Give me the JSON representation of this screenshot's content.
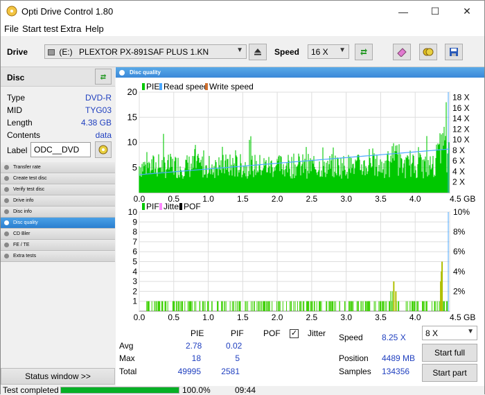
{
  "window": {
    "title": "Opti Drive Control 1.80",
    "minimize": "—",
    "maximize": "☐",
    "close": "✕"
  },
  "menu": {
    "file": "File",
    "start_test": "Start test",
    "extra": "Extra",
    "help": "Help"
  },
  "toolbar": {
    "drive_label": "Drive",
    "drive_letter": "(E:)",
    "drive_name": "PLEXTOR PX-891SAF PLUS 1.KN",
    "speed_label": "Speed",
    "speed_value": "16 X"
  },
  "disc": {
    "header": "Disc",
    "type_label": "Type",
    "type_value": "DVD-R",
    "mid_label": "MID",
    "mid_value": "TYG03",
    "length_label": "Length",
    "length_value": "4.38 GB",
    "contents_label": "Contents",
    "contents_value": "data",
    "label_label": "Label",
    "label_value": "ODC__DVD"
  },
  "nav": {
    "items": [
      "Transfer rate",
      "Create test disc",
      "Verify test disc",
      "Drive info",
      "Disc info",
      "Disc quality",
      "CD Bler",
      "FE / TE",
      "Extra tests"
    ],
    "active_index": 5
  },
  "status_window_button": "Status window >>",
  "panel_title": "Disc quality",
  "chart_data": [
    {
      "type": "area",
      "legend": [
        "PIE",
        "Read speed",
        "Write speed"
      ],
      "legend_colors": [
        "#00c800",
        "#4aa8ff",
        "#d07030"
      ],
      "x_ticks": [
        "0.0",
        "0.5",
        "1.0",
        "1.5",
        "2.0",
        "2.5",
        "3.0",
        "3.5",
        "4.0",
        "4.5 GB"
      ],
      "y_ticks_left": [
        "20",
        "15",
        "10",
        "5"
      ],
      "y_ticks_right": [
        "18 X",
        "16 X",
        "14 X",
        "12 X",
        "10 X",
        "8 X",
        "6 X",
        "4 X",
        "2 X"
      ],
      "xlim": [
        0,
        4.5
      ],
      "ylim": [
        0,
        20
      ],
      "pie_avg": 2.78,
      "pie_max": 18,
      "read_speed_start": 3.4,
      "read_speed_end": 8.25
    },
    {
      "type": "bar",
      "legend": [
        "PIF",
        "Jitter",
        "POF"
      ],
      "legend_colors": [
        "#00c800",
        "#ff88ff",
        "#000000"
      ],
      "x_ticks": [
        "0.0",
        "0.5",
        "1.0",
        "1.5",
        "2.0",
        "2.5",
        "3.0",
        "3.5",
        "4.0",
        "4.5 GB"
      ],
      "y_ticks_left": [
        "10",
        "9",
        "8",
        "7",
        "6",
        "5",
        "4",
        "3",
        "2",
        "1"
      ],
      "y_ticks_right": [
        "10%",
        "8%",
        "6%",
        "4%",
        "2%"
      ],
      "xlim": [
        0,
        4.5
      ],
      "ylim": [
        0,
        10
      ],
      "pif_avg": 0.02,
      "pif_max": 5
    }
  ],
  "stats": {
    "col_pie": "PIE",
    "col_pif": "PIF",
    "col_pof": "POF",
    "col_jitter": "Jitter",
    "avg_label": "Avg",
    "avg_pie": "2.78",
    "avg_pif": "0.02",
    "max_label": "Max",
    "max_pie": "18",
    "max_pif": "5",
    "total_label": "Total",
    "total_pie": "49995",
    "total_pif": "2581",
    "speed_label": "Speed",
    "speed_value": "8.25 X",
    "position_label": "Position",
    "position_value": "4489 MB",
    "samples_label": "Samples",
    "samples_value": "134356",
    "speed_select": "8 X",
    "start_full": "Start full",
    "start_part": "Start part",
    "jitter_checked": "✓"
  },
  "statusbar": {
    "status": "Test completed",
    "progress_percent": 100,
    "percent": "100.0%",
    "time": "09:44"
  }
}
